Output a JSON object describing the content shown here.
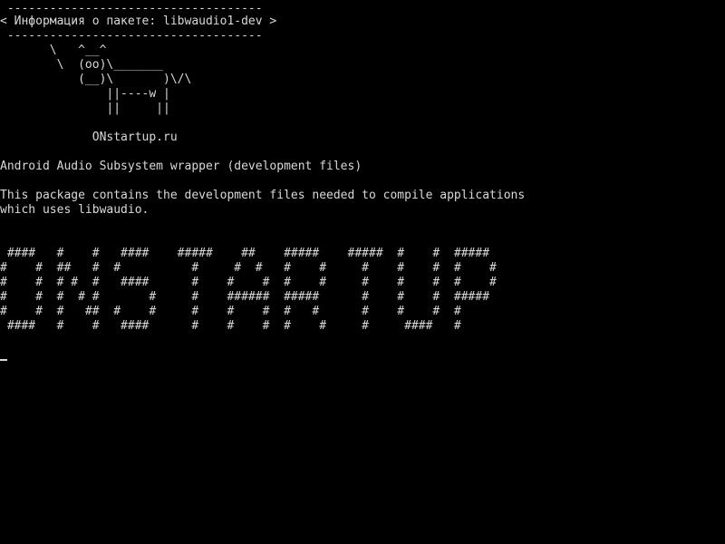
{
  "terminal": {
    "bubble": {
      "top_border": " ------------------------------------",
      "title": "< Информация о пакете: libwaudio1-dev >",
      "bottom_border": " ------------------------------------"
    },
    "cow": [
      "       \\   ^__^",
      "        \\  (oo)\\_______",
      "           (__)\\       )\\/\\",
      "               ||----w |",
      "               ||     ||"
    ],
    "site": "             ONstartup.ru",
    "package_summary": "Android Audio Subsystem wrapper (development files)",
    "description": [
      "This package contains the development files needed to compile applications",
      "which uses libwaudio."
    ],
    "banner": [
      " ####   #    #   ####    #####    ##    #####    #####  #    #  #####",
      "#    #  ##   #  #          #     #  #   #    #     #    #    #  #    #",
      "#    #  # #  #   ####      #    #    #  #    #     #    #    #  #    #",
      "#    #  #  # #       #     #    ######  #####      #    #    #  #####",
      "#    #  #   ##  #    #     #    #    #  #   #      #    #    #  #",
      " ####   #    #   ####      #    #    #  #    #     #     ####   #"
    ]
  }
}
